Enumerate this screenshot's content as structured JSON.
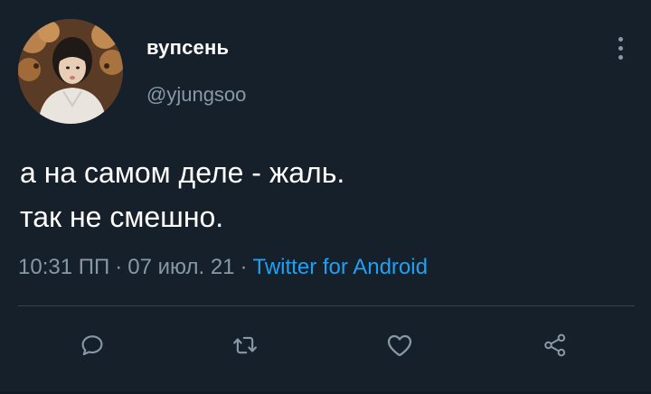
{
  "tweet": {
    "author": {
      "display_name": "вупсень",
      "handle": "@yjungsoo"
    },
    "text_lines": [
      "а на самом деле - жаль.",
      "так не смешно."
    ],
    "meta": {
      "time": "10:31 ПП",
      "separator": "·",
      "date": "07 июл. 21",
      "source": "Twitter for Android"
    },
    "actions": {
      "reply_icon": "reply-icon",
      "retweet_icon": "retweet-icon",
      "like_icon": "heart-icon",
      "share_icon": "share-icon"
    }
  },
  "colors": {
    "background": "#15202b",
    "text_primary": "#ffffff",
    "text_secondary": "#8899a6",
    "link": "#1da1f2",
    "divider": "#38444d"
  }
}
